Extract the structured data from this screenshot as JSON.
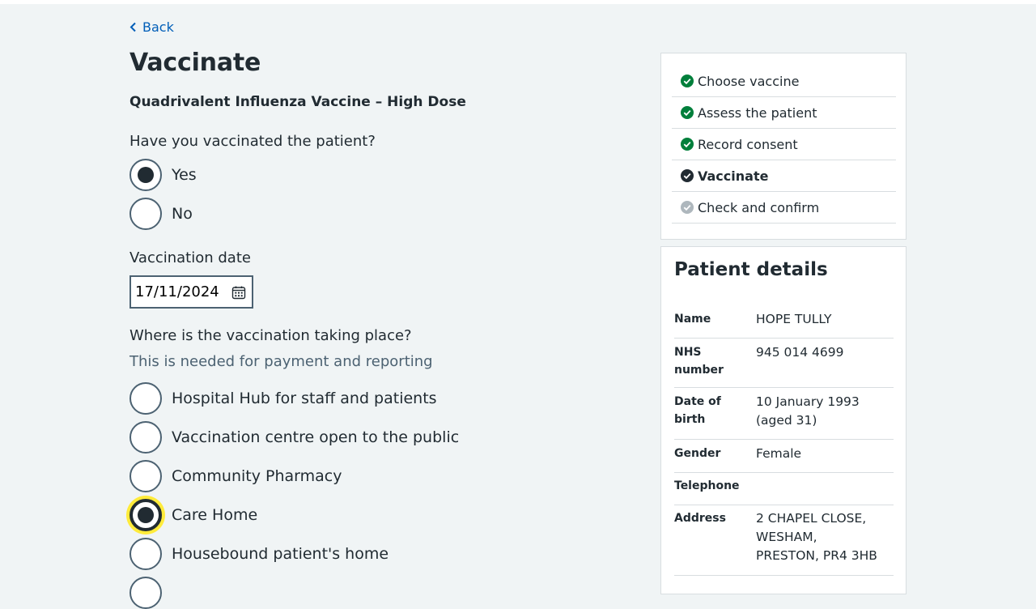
{
  "back_link": "Back",
  "page_title": "Vaccinate",
  "vaccine_name": "Quadrivalent Influenza Vaccine – High Dose",
  "vaccinated_question": {
    "legend": "Have you vaccinated the patient?",
    "options": [
      "Yes",
      "No"
    ],
    "selected": "Yes"
  },
  "vaccination_date": {
    "label": "Vaccination date",
    "value": "17/11/2024"
  },
  "location_question": {
    "legend": "Where is the vaccination taking place?",
    "hint": "This is needed for payment and reporting",
    "options": [
      "Hospital Hub for staff and patients",
      "Vaccination centre open to the public",
      "Community Pharmacy",
      "Care Home",
      "Housebound patient's home"
    ],
    "selected": "Care Home"
  },
  "task_list": [
    {
      "label": "Choose vaccine",
      "status": "complete"
    },
    {
      "label": "Assess the patient",
      "status": "complete"
    },
    {
      "label": "Record consent",
      "status": "complete"
    },
    {
      "label": "Vaccinate",
      "status": "current"
    },
    {
      "label": "Check and confirm",
      "status": "pending"
    }
  ],
  "patient_details": {
    "title": "Patient details",
    "rows": [
      {
        "key": "Name",
        "value": "HOPE TULLY"
      },
      {
        "key": "NHS number",
        "value": "945 014 4699"
      },
      {
        "key": "Date of birth",
        "value": "10 January 1993 (aged 31)"
      },
      {
        "key": "Gender",
        "value": "Female"
      },
      {
        "key": "Telephone",
        "value": ""
      },
      {
        "key": "Address",
        "value": "2 CHAPEL CLOSE, WESHAM, PRESTON, PR4 3HB"
      }
    ]
  },
  "colors": {
    "background": "#f0f4f5",
    "link": "#005eb8",
    "complete": "#007f3b",
    "text": "#212b32",
    "pending": "#aeb7bd",
    "focus": "#ffeb3b"
  }
}
